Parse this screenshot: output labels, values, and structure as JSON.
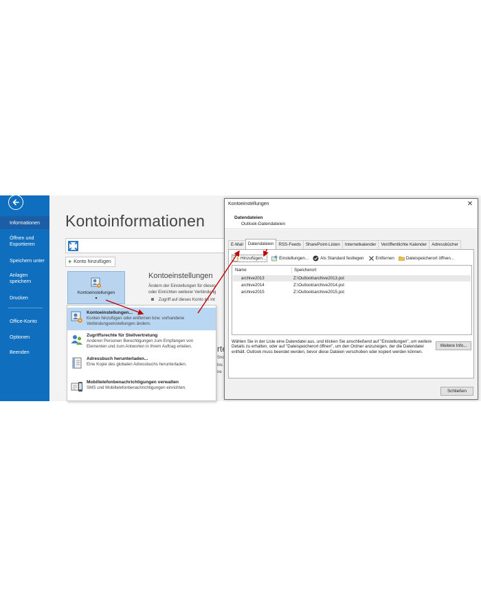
{
  "colors": {
    "sidebar": "#106ebe",
    "sidebar_active": "#1b5ea6",
    "tile_highlight": "#b8d4ef",
    "arrow": "#c00000"
  },
  "sidebar": {
    "back_icon": "arrow-left-circle-icon",
    "items": [
      {
        "label": "Informationen",
        "active": true
      },
      {
        "label": "Öffnen und Exportieren"
      },
      {
        "label": "Speichern unter"
      },
      {
        "label": "Anlagen speichern"
      },
      {
        "label": "Drucken"
      },
      {
        "label": "Office-Konto"
      },
      {
        "label": "Optionen"
      },
      {
        "label": "Beenden"
      }
    ]
  },
  "main": {
    "title": "Kontoinformationen",
    "add_account_label": "Konto hinzufügen",
    "settings_tile_label": "Kontoeinstellungen",
    "settings_tile_caret": "▾",
    "settings_heading": "Kontoeinstellungen",
    "settings_desc_1": "Ändern der Einstellungen für dieses",
    "settings_desc_2": "oder Einrichten weiterer Verbindung",
    "settings_bullet": "Zugriff auf dieses Konto im Int",
    "partial_1": "rte",
    "partial_2": "Snc",
    "partial_3": "hiv.",
    "partial_4": "ne"
  },
  "dropdown": {
    "items": [
      {
        "title": "Kontoeinstellungen...",
        "desc": "Konten hinzufügen oder entfernen bzw. vorhandene Verbindungseinstellungen ändern."
      },
      {
        "title": "Zugriffsrechte für Stellvertretung",
        "desc": "Anderen Personen Berechtigungen zum Empfangen von Elementen und zum Antworten in Ihrem Auftrag erteilen."
      },
      {
        "title": "Adressbuch herunterladen...",
        "desc": "Eine Kopie des globalen Adressbuchs herunterladen."
      },
      {
        "title": "Mobiltelefonbenachrichtigungen verwalten",
        "desc": "SMS und Mobiltelefonbenachrichtigungen einrichten."
      }
    ]
  },
  "dialog": {
    "title": "Kontoeinstellungen",
    "close_symbol": "✕",
    "header_title": "Datendateien",
    "header_subtitle": "Outlook-Datendateien",
    "tabs": [
      "E-Mail",
      "Datendateien",
      "RSS-Feeds",
      "SharePoint-Listen",
      "Internetkalender",
      "Veröffentlichte Kalender",
      "Adressbücher"
    ],
    "active_tab": 1,
    "toolbar": {
      "add": "Hinzufügen...",
      "settings": "Einstellungen...",
      "set_default": "Als Standard festlegen",
      "remove": "Entfernen",
      "open_location": "Dateispeicherort öffnen..."
    },
    "columns": [
      "Name",
      "Speicherort"
    ],
    "files": [
      {
        "name": "archive2013",
        "path": "Z:\\Outlook\\archive2013.pst"
      },
      {
        "name": "archive2014",
        "path": "Z:\\Outlook\\archive2014.pst"
      },
      {
        "name": "archive2015",
        "path": "Z:\\Outlook\\archive2015.pst"
      }
    ],
    "hint": "Wählen Sie in der Liste eine Datendatei aus, und klicken Sie anschließend auf \"Einstellungen\", um weitere Details zu erhalten, oder auf \"Dateispeicherort öffnen\", um den Ordner anzuzeigen, der die Datendatei enthält. Outlook muss beendet werden, bevor diese Dateien verschoben oder kopiert werden können.",
    "more_info": "Weitere Info...",
    "close_button": "Schließen"
  }
}
